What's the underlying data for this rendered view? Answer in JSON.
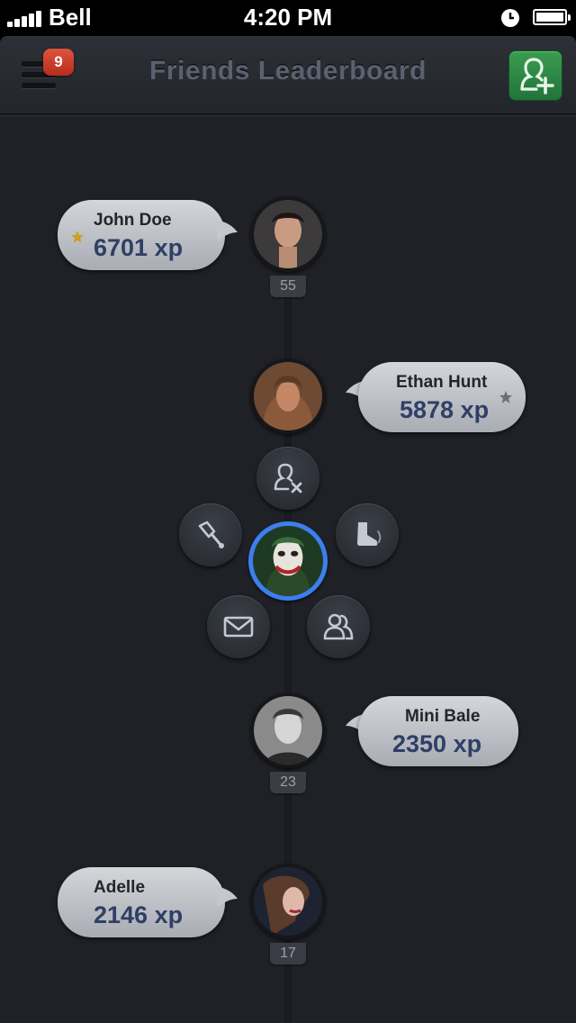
{
  "status_bar": {
    "carrier": "Bell",
    "time": "4:20 PM",
    "signal_icon": "signal-bars-icon",
    "alarm_icon": "alarm-clock-icon",
    "battery_icon": "battery-icon"
  },
  "navbar": {
    "title": "Friends Leaderboard",
    "menu_icon": "hamburger-menu-icon",
    "notification_count": "9",
    "add_friend_icon": "add-friend-icon"
  },
  "colors": {
    "background": "#1f2126",
    "badge": "#c9402b",
    "add_button": "#2d8a45",
    "selected_ring": "#3d7ef0",
    "xp_text": "#2f3f66"
  },
  "leaderboard": [
    {
      "name": "John Doe",
      "xp": "6701 xp",
      "rank": "55",
      "starred": true,
      "star_color": "#c9a21f"
    },
    {
      "name": "Ethan Hunt",
      "xp": "5878 xp",
      "starred": true,
      "star_color": "#6b6f77"
    },
    {
      "name": "Mini Bale",
      "xp": "2350 xp",
      "rank": "23",
      "starred": false
    },
    {
      "name": "Adelle",
      "xp": "2146 xp",
      "rank": "17",
      "starred": false
    }
  ],
  "radial_menu": {
    "actions": [
      {
        "icon": "remove-friend-icon"
      },
      {
        "icon": "pen-edit-icon"
      },
      {
        "icon": "kick-boot-icon"
      },
      {
        "icon": "mail-icon"
      },
      {
        "icon": "group-icon"
      }
    ]
  }
}
